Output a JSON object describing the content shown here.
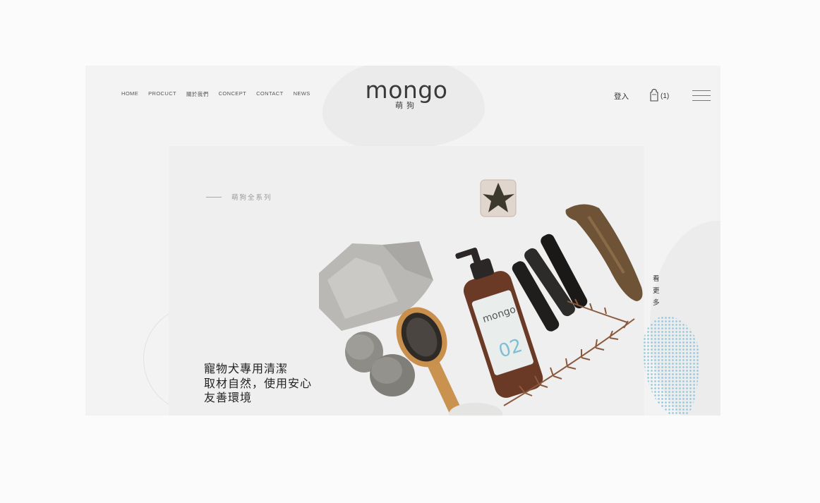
{
  "nav": {
    "items": [
      "HOME",
      "PROCUCT",
      "關於我們",
      "CONCEPT",
      "CONTACT",
      "NEWS"
    ]
  },
  "logo": {
    "word": "mongo",
    "sub": "萌狗"
  },
  "header": {
    "login_label": "登入",
    "cart_count": "(1)"
  },
  "icons": {
    "cart": "bag-icon",
    "menu": "hamburger-menu-icon"
  },
  "hero": {
    "eyebrow": "萌狗全系列",
    "tagline": [
      "寵物犬專用清潔",
      "取材自然，使用安心",
      "友善環境"
    ],
    "bottle_label": "02"
  },
  "side": {
    "see_more": "看更多"
  },
  "colors": {
    "accent_dots": "#8cc6db",
    "background": "#f3f3f3"
  }
}
